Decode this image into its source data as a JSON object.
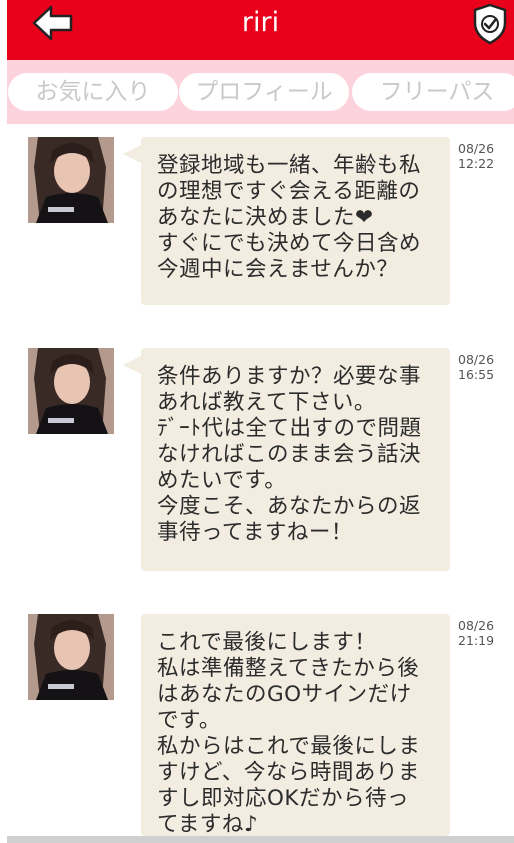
{
  "header": {
    "title": "riri",
    "back_icon": "back-arrow-icon",
    "shield_icon": "verified-shield-icon",
    "color": "#e9001b"
  },
  "tabs": [
    {
      "label": "お気に入り"
    },
    {
      "label": "プロフィール"
    },
    {
      "label": "フリーパス"
    }
  ],
  "messages": [
    {
      "text": "登録地域も一緒、年齢も私\nの理想ですぐ会える距離の\nあなたに決めました❤\nすぐにでも決めて今日含め\n今週中に会えませんか？",
      "date": "08/26",
      "time": "12:22"
    },
    {
      "text": "条件ありますか？必要な事\nあれば教えて下さい。\nﾃﾞｰﾄ代は全て出すので問題\nなければこのまま会う話決\nめたいです。\n今度こそ、あなたからの返\n事待ってますねー！",
      "date": "08/26",
      "time": "16:55"
    },
    {
      "text": "これで最後にします！\n私は準備整えてきたから後\nはあなたのGOサインだけ\nです。\n私からはこれで最後にしま\nすけど、今なら時間ありま\nすし即対応OKだから待っ\nてますね♪",
      "date": "08/26",
      "time": "21:19"
    }
  ]
}
